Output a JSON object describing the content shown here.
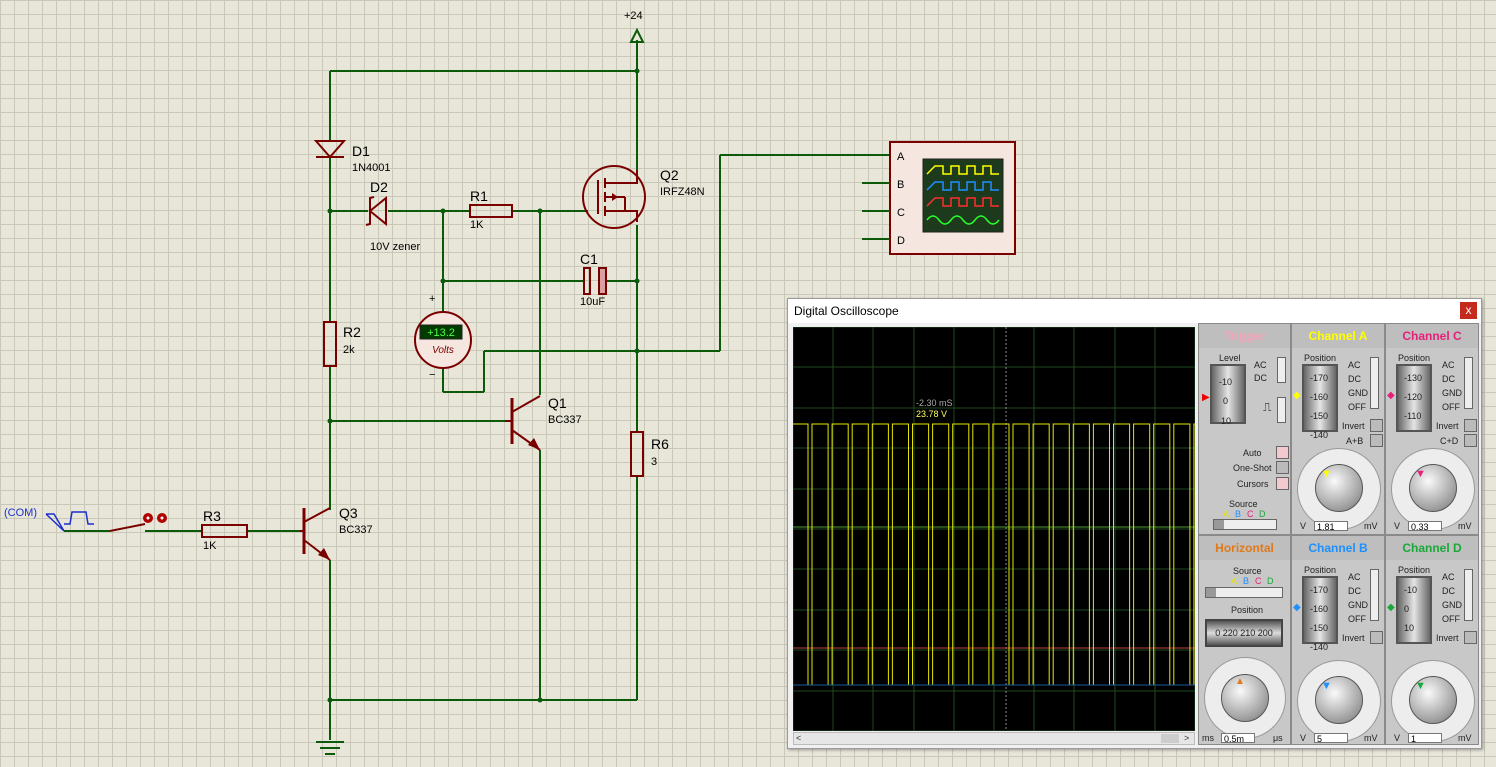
{
  "schematic": {
    "supply_label": "+24",
    "components": {
      "d1": {
        "ref": "D1",
        "value": "1N4001"
      },
      "d2": {
        "ref": "D2",
        "value": "10V zener"
      },
      "r1": {
        "ref": "R1",
        "value": "1K"
      },
      "q2": {
        "ref": "Q2",
        "value": "IRFZ48N"
      },
      "c1": {
        "ref": "C1",
        "value": "10uF"
      },
      "r2": {
        "ref": "R2",
        "value": "2k"
      },
      "q1": {
        "ref": "Q1",
        "value": "BC337"
      },
      "r6": {
        "ref": "R6",
        "value": "3"
      },
      "r3": {
        "ref": "R3",
        "value": "1K"
      },
      "q3": {
        "ref": "Q3",
        "value": "BC337"
      }
    },
    "voltmeter": {
      "reading": "+13.2",
      "unit": "Volts",
      "plus": "+",
      "minus": "−"
    },
    "port_label": "(COM)",
    "scope_symbol": {
      "channels": [
        "A",
        "B",
        "C",
        "D"
      ]
    }
  },
  "oscilloscope": {
    "title": "Digital Oscilloscope",
    "close": "x",
    "readout_time": "-2.30 mS",
    "readout_volt": "23.78 V",
    "trigger": {
      "title": "Trigger",
      "level_label": "Level",
      "level_ticks": [
        "-10",
        "0",
        "10"
      ],
      "coupling": [
        "AC",
        "DC"
      ],
      "auto": "Auto",
      "one_shot": "One-Shot",
      "cursors": "Cursors",
      "source_label": "Source",
      "sources": [
        "A",
        "B",
        "C",
        "D"
      ]
    },
    "horizontal": {
      "title": "Horizontal",
      "source_label": "Source",
      "sources": [
        "A",
        "B",
        "C",
        "D"
      ],
      "position_label": "Position",
      "position_ticks": "0 220 210 200",
      "dial_ticks": [
        "0.5",
        "0.2",
        "0.1",
        "50",
        "20",
        "10",
        "5",
        "2",
        "1",
        "0.5",
        "0.2",
        "1",
        "2",
        "5",
        "10",
        "20",
        "50",
        "100",
        "200"
      ],
      "unit_left": "ms",
      "value": "0.5m",
      "unit_right": "μs"
    },
    "channels": [
      {
        "title": "Channel A",
        "color": "#ffff00",
        "position_label": "Position",
        "pos_ticks": [
          "-170",
          "-160",
          "-150",
          "-140"
        ],
        "modes": [
          "AC",
          "DC",
          "GND",
          "OFF"
        ],
        "invert": "Invert",
        "extra": "A+B",
        "value": "1.81",
        "unit_left": "V",
        "unit_right": "mV",
        "ticks": [
          "0.5",
          "0.2",
          "0.1",
          "50",
          "20",
          "10",
          "5",
          "2",
          "1",
          "2",
          "5",
          "10",
          "20",
          "2",
          "5",
          "10",
          "20",
          "50"
        ]
      },
      {
        "title": "Channel C",
        "color": "#e8207a",
        "position_label": "Position",
        "pos_ticks": [
          "-130",
          "-120",
          "-110"
        ],
        "modes": [
          "AC",
          "DC",
          "GND",
          "OFF"
        ],
        "invert": "Invert",
        "extra": "C+D",
        "value": "0.33",
        "unit_left": "V",
        "unit_right": "mV",
        "ticks": [
          "0.5",
          "0.2",
          "0.1",
          "50",
          "20",
          "10",
          "5",
          "2",
          "1",
          "2",
          "5",
          "10",
          "20",
          "2",
          "5",
          "10",
          "20",
          "50"
        ]
      },
      {
        "title": "Channel B",
        "color": "#1e90ff",
        "position_label": "Position",
        "pos_ticks": [
          "-170",
          "-160",
          "-150",
          "-140"
        ],
        "modes": [
          "AC",
          "DC",
          "GND",
          "OFF"
        ],
        "invert": "Invert",
        "extra": "",
        "value": "5",
        "unit_left": "V",
        "unit_right": "mV",
        "ticks": [
          "0.5",
          "0.2",
          "0.1",
          "50",
          "20",
          "10",
          "5",
          "2",
          "1",
          "2",
          "5",
          "10",
          "20",
          "2",
          "5",
          "10",
          "20",
          "50"
        ]
      },
      {
        "title": "Channel D",
        "color": "#1aa83a",
        "position_label": "Position",
        "pos_ticks": [
          "-10",
          "0",
          "10"
        ],
        "modes": [
          "AC",
          "DC",
          "GND",
          "OFF"
        ],
        "invert": "Invert",
        "extra": "",
        "value": "1",
        "unit_left": "V",
        "unit_right": "mV",
        "ticks": [
          "0.5",
          "0.2",
          "0.1",
          "50",
          "20",
          "10",
          "5",
          "2",
          "1",
          "2",
          "5",
          "10",
          "20",
          "2",
          "5",
          "10",
          "20",
          "50"
        ]
      }
    ]
  }
}
